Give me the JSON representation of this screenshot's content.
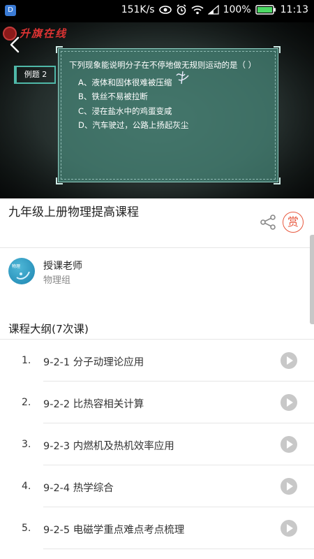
{
  "status_bar": {
    "app_icon": "app-icon",
    "net_speed": "151K/s",
    "battery_percent": "100%",
    "time": "11:13"
  },
  "video": {
    "logo_text": "升旗在线",
    "example_tag": "例题 2",
    "question": "下列现象能说明分子在不停地做无规则运动的是（    ）",
    "options": [
      "A、液体和固体很难被压缩",
      "B、铁丝不易被拉断",
      "C、浸在盐水中的鸡蛋变咸",
      "D、汽车驶过，公路上扬起灰尘"
    ]
  },
  "course": {
    "title": "九年级上册物理提高课程",
    "reward_label": "赏"
  },
  "teacher": {
    "avatar_text": "物理",
    "label": "授课老师",
    "name": "物理组"
  },
  "outline": {
    "title": "课程大纲(7次课)",
    "lessons": [
      {
        "num": "1.",
        "title": "9-2-1 分子动理论应用"
      },
      {
        "num": "2.",
        "title": "9-2-2 比热容相关计算"
      },
      {
        "num": "3.",
        "title": "9-2-3 内燃机及热机效率应用"
      },
      {
        "num": "4.",
        "title": "9-2-4 热学综合"
      },
      {
        "num": "5.",
        "title": "9-2-5 电磁学重点难点考点梳理"
      }
    ]
  }
}
